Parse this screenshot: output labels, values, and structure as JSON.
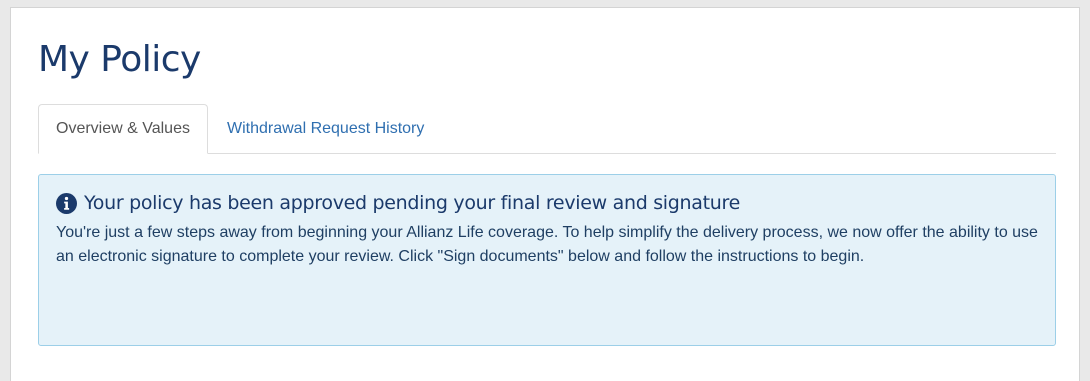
{
  "page": {
    "title": "My Policy"
  },
  "tabs": [
    {
      "label": "Overview & Values",
      "active": true
    },
    {
      "label": "Withdrawal Request History",
      "active": false
    }
  ],
  "alert": {
    "icon": "info-circle-icon",
    "title": "Your policy has been approved pending your final review and signature",
    "body": "You're just a few steps away from beginning your Allianz Life coverage. To help simplify the delivery process, we now offer the ability to use an electronic signature to complete your review. Click \"Sign documents\" below and follow the instructions to begin."
  },
  "colors": {
    "title": "#1b3a6b",
    "link": "#2f6fb0",
    "alert_bg": "#e5f2f9",
    "alert_border": "#9ccfe8"
  }
}
